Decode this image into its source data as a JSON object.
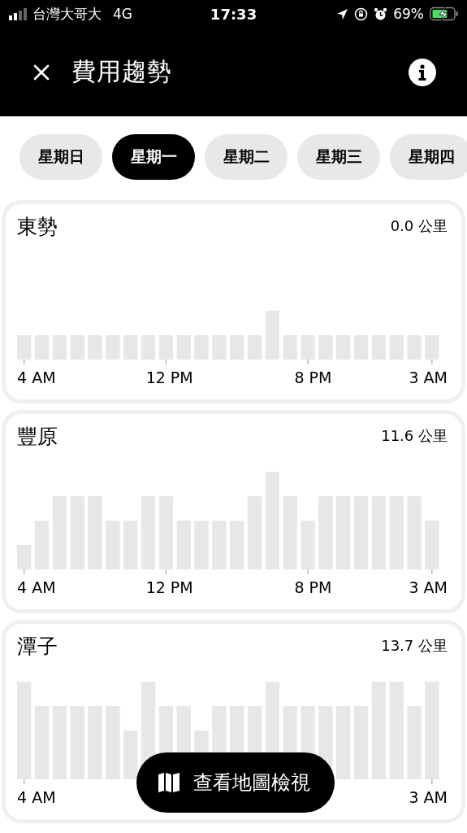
{
  "status_bar": {
    "carrier": "台灣大哥大",
    "network": "4G",
    "time": "17:33",
    "battery": "69%"
  },
  "header": {
    "title": "費用趨勢"
  },
  "days": [
    {
      "label": "星期日",
      "selected": false
    },
    {
      "label": "星期一",
      "selected": true
    },
    {
      "label": "星期二",
      "selected": false
    },
    {
      "label": "星期三",
      "selected": false
    },
    {
      "label": "星期四",
      "selected": false
    }
  ],
  "regions": [
    {
      "name": "東勢",
      "distance": "0.0 公里",
      "axis_labels": {
        "start": "4 AM",
        "left": "12 PM",
        "right": "8 PM",
        "end": "3 AM"
      }
    },
    {
      "name": "豐原",
      "distance": "11.6 公里",
      "axis_labels": {
        "start": "4 AM",
        "left": "12 PM",
        "right": "8 PM",
        "end": "3 AM"
      }
    },
    {
      "name": "潭子",
      "distance": "13.7 公里",
      "axis_labels": {
        "start": "4 AM",
        "end": "3 AM"
      }
    }
  ],
  "map_button": {
    "label": "查看地圖檢視"
  }
}
